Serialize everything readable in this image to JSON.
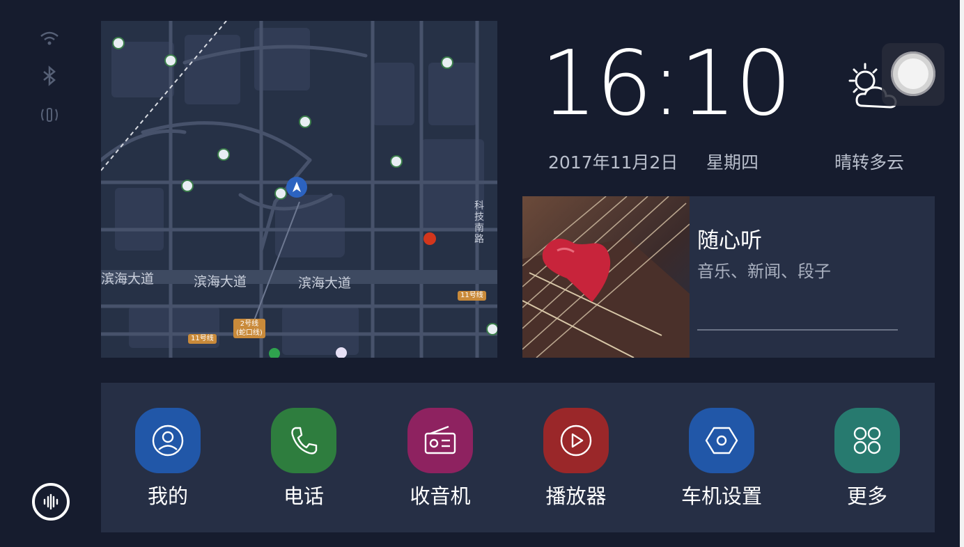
{
  "status": {
    "icons": [
      "wifi-icon",
      "bluetooth-icon",
      "signal-icon"
    ],
    "voice_icon": "voice-assistant-icon"
  },
  "map": {
    "road_labels": [
      "滨海大道",
      "滨海大道",
      "滨海大道"
    ],
    "vertical_label": "科技南路",
    "badges": [
      "11号线",
      "2号线",
      "(蛇口线)",
      "11号线"
    ],
    "location_icon": "navigation-arrow-icon"
  },
  "clock": {
    "time": "16:10",
    "date": "2017年11月2日",
    "weekday": "星期四",
    "weather": "晴转多云",
    "weather_icon": "partly-cloudy-icon"
  },
  "music": {
    "title": "随心听",
    "subtitle": "音乐、新闻、段子"
  },
  "dock": {
    "apps": [
      {
        "label": "我的",
        "icon": "user-icon",
        "color": "#2157a8"
      },
      {
        "label": "电话",
        "icon": "phone-icon",
        "color": "#2e7d3e"
      },
      {
        "label": "收音机",
        "icon": "radio-icon",
        "color": "#8e2260"
      },
      {
        "label": "播放器",
        "icon": "play-icon",
        "color": "#9a2729"
      },
      {
        "label": "车机设置",
        "icon": "settings-hex-icon",
        "color": "#2157a8"
      },
      {
        "label": "更多",
        "icon": "more-grid-icon",
        "color": "#277a6f"
      }
    ]
  },
  "colors": {
    "background": "#161c2e",
    "panel": "#262f45"
  }
}
